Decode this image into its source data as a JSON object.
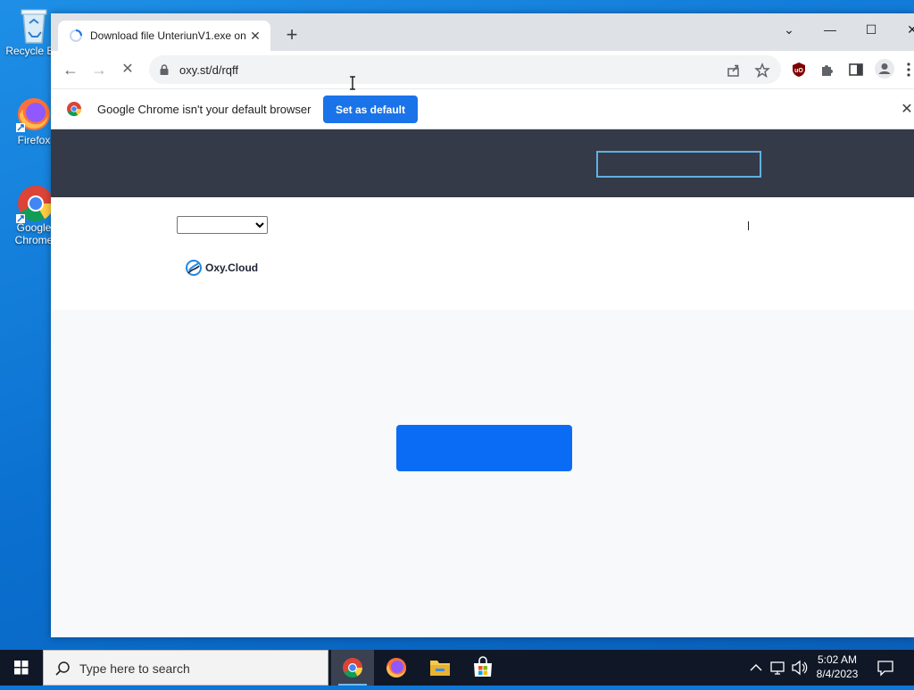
{
  "desktop": {
    "icons": [
      {
        "label": "Recycle Bin",
        "icon": "recycle-bin-icon"
      },
      {
        "label": "Firefox",
        "icon": "firefox-icon"
      },
      {
        "label": "Google Chrome",
        "icon": "chrome-icon"
      }
    ]
  },
  "browser": {
    "tab": {
      "title": "Download file UnteriunV1.exe on",
      "close_glyph": "✕"
    },
    "newtab_glyph": "+",
    "window_controls": {
      "dropdown": "⌄",
      "minimize": "—",
      "maximize": "☐",
      "close": "✕"
    },
    "toolbar": {
      "back_glyph": "←",
      "forward_glyph": "→",
      "stop_glyph": "✕",
      "url": "oxy.st/d/rqff"
    },
    "infobar": {
      "message": "Google Chrome isn't your default browser",
      "button": "Set as default",
      "close_glyph": "✕"
    }
  },
  "page": {
    "language_select": {
      "value": ""
    },
    "logo_text": "Oxy.Cloud",
    "colors": {
      "header": "#353a48",
      "download_button": "#0a6cf5",
      "header_box_border": "#5fb0e0"
    }
  },
  "taskbar": {
    "search_placeholder": "Type here to search",
    "apps": [
      "chrome-icon",
      "firefox-icon",
      "file-explorer-icon",
      "microsoft-store-icon"
    ],
    "clock": {
      "time": "5:02 AM",
      "date": "8/4/2023"
    }
  }
}
